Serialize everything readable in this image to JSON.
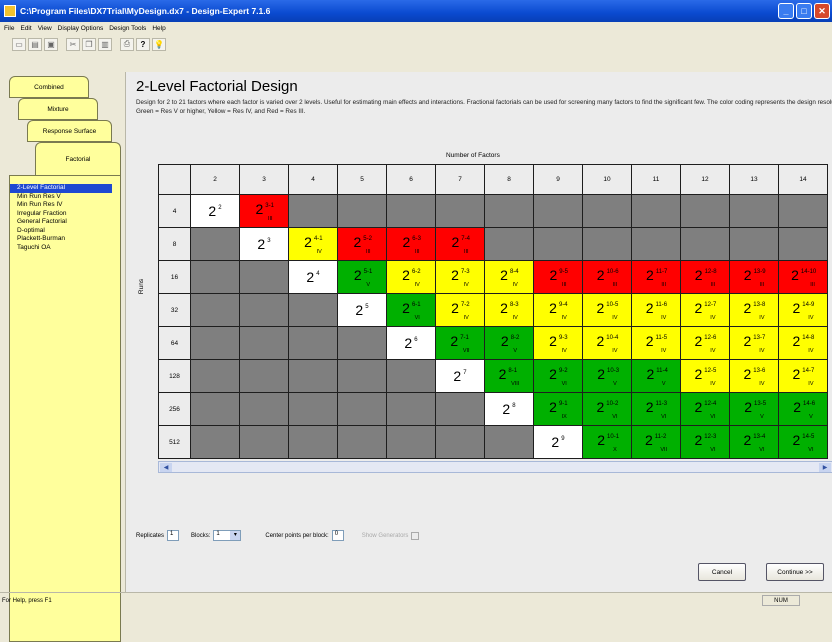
{
  "window": {
    "title": "C:\\Program Files\\DX7Trial\\MyDesign.dx7 - Design-Expert 7.1.6",
    "controls": [
      "_",
      "□",
      "✕"
    ]
  },
  "menu": [
    "File",
    "Edit",
    "View",
    "Display Options",
    "Design Tools",
    "Help"
  ],
  "toolbar": {
    "help_label": "?",
    "tip_label": "💡"
  },
  "tabs": [
    "Combined",
    "Mixture",
    "Response Surface",
    "Factorial"
  ],
  "nav_items": [
    "2-Level Factorial",
    "Min Run Res V",
    "Min Run Res IV",
    "Irregular Fraction",
    "General Factorial",
    "D-optimal",
    "Plackett-Burman",
    "Taguchi OA"
  ],
  "main": {
    "title": "2-Level Factorial Design",
    "description": "Design for 2 to 21 factors where each factor is varied over 2 levels. Useful for estimating main effects and interactions. Fractional factorials can be used for screening many factors to find the significant few. The color coding represents the design resolution: Green = Res V or higher, Yellow = Res IV, and Red = Res III.",
    "factors_label": "Number of Factors",
    "runs_label": "Runs"
  },
  "grid": {
    "factor_headers": [
      "2",
      "3",
      "4",
      "5",
      "6",
      "7",
      "8",
      "9",
      "10",
      "11",
      "12",
      "13",
      "14"
    ],
    "rows": [
      {
        "runs": "4",
        "cells": [
          {
            "c": "white",
            "s": "2"
          },
          {
            "c": "red",
            "s": "3-1",
            "r": "III"
          },
          {
            "c": "empty"
          },
          {
            "c": "empty"
          },
          {
            "c": "empty"
          },
          {
            "c": "empty"
          },
          {
            "c": "empty"
          },
          {
            "c": "empty"
          },
          {
            "c": "empty"
          },
          {
            "c": "empty"
          },
          {
            "c": "empty"
          },
          {
            "c": "empty"
          },
          {
            "c": "empty"
          }
        ]
      },
      {
        "runs": "8",
        "cells": [
          {
            "c": "empty"
          },
          {
            "c": "white",
            "s": "3"
          },
          {
            "c": "yellow",
            "s": "4-1",
            "r": "IV"
          },
          {
            "c": "red",
            "s": "5-2",
            "r": "III"
          },
          {
            "c": "red",
            "s": "6-3",
            "r": "III"
          },
          {
            "c": "red",
            "s": "7-4",
            "r": "III"
          },
          {
            "c": "empty"
          },
          {
            "c": "empty"
          },
          {
            "c": "empty"
          },
          {
            "c": "empty"
          },
          {
            "c": "empty"
          },
          {
            "c": "empty"
          },
          {
            "c": "empty"
          }
        ]
      },
      {
        "runs": "16",
        "cells": [
          {
            "c": "empty"
          },
          {
            "c": "empty"
          },
          {
            "c": "white",
            "s": "4"
          },
          {
            "c": "green",
            "s": "5-1",
            "r": "V"
          },
          {
            "c": "yellow",
            "s": "6-2",
            "r": "IV"
          },
          {
            "c": "yellow",
            "s": "7-3",
            "r": "IV"
          },
          {
            "c": "yellow",
            "s": "8-4",
            "r": "IV"
          },
          {
            "c": "red",
            "s": "9-5",
            "r": "III"
          },
          {
            "c": "red",
            "s": "10-6",
            "r": "III"
          },
          {
            "c": "red",
            "s": "11-7",
            "r": "III"
          },
          {
            "c": "red",
            "s": "12-8",
            "r": "III"
          },
          {
            "c": "red",
            "s": "13-9",
            "r": "III"
          },
          {
            "c": "red",
            "s": "14-10",
            "r": "III"
          }
        ]
      },
      {
        "runs": "32",
        "cells": [
          {
            "c": "empty"
          },
          {
            "c": "empty"
          },
          {
            "c": "empty"
          },
          {
            "c": "white",
            "s": "5"
          },
          {
            "c": "green",
            "s": "6-1",
            "r": "VI"
          },
          {
            "c": "yellow",
            "s": "7-2",
            "r": "IV"
          },
          {
            "c": "yellow",
            "s": "8-3",
            "r": "IV"
          },
          {
            "c": "yellow",
            "s": "9-4",
            "r": "IV"
          },
          {
            "c": "yellow",
            "s": "10-5",
            "r": "IV"
          },
          {
            "c": "yellow",
            "s": "11-6",
            "r": "IV"
          },
          {
            "c": "yellow",
            "s": "12-7",
            "r": "IV"
          },
          {
            "c": "yellow",
            "s": "13-8",
            "r": "IV"
          },
          {
            "c": "yellow",
            "s": "14-9",
            "r": "IV"
          }
        ]
      },
      {
        "runs": "64",
        "cells": [
          {
            "c": "empty"
          },
          {
            "c": "empty"
          },
          {
            "c": "empty"
          },
          {
            "c": "empty"
          },
          {
            "c": "white",
            "s": "6"
          },
          {
            "c": "green",
            "s": "7-1",
            "r": "VII"
          },
          {
            "c": "green",
            "s": "8-2",
            "r": "V"
          },
          {
            "c": "yellow",
            "s": "9-3",
            "r": "IV"
          },
          {
            "c": "yellow",
            "s": "10-4",
            "r": "IV"
          },
          {
            "c": "yellow",
            "s": "11-5",
            "r": "IV"
          },
          {
            "c": "yellow",
            "s": "12-6",
            "r": "IV"
          },
          {
            "c": "yellow",
            "s": "13-7",
            "r": "IV"
          },
          {
            "c": "yellow",
            "s": "14-8",
            "r": "IV"
          }
        ]
      },
      {
        "runs": "128",
        "cells": [
          {
            "c": "empty"
          },
          {
            "c": "empty"
          },
          {
            "c": "empty"
          },
          {
            "c": "empty"
          },
          {
            "c": "empty"
          },
          {
            "c": "white",
            "s": "7"
          },
          {
            "c": "green",
            "s": "8-1",
            "r": "VIII"
          },
          {
            "c": "green",
            "s": "9-2",
            "r": "VI"
          },
          {
            "c": "green",
            "s": "10-3",
            "r": "V"
          },
          {
            "c": "green",
            "s": "11-4",
            "r": "V"
          },
          {
            "c": "yellow",
            "s": "12-5",
            "r": "IV"
          },
          {
            "c": "yellow",
            "s": "13-6",
            "r": "IV"
          },
          {
            "c": "yellow",
            "s": "14-7",
            "r": "IV"
          }
        ]
      },
      {
        "runs": "256",
        "cells": [
          {
            "c": "empty"
          },
          {
            "c": "empty"
          },
          {
            "c": "empty"
          },
          {
            "c": "empty"
          },
          {
            "c": "empty"
          },
          {
            "c": "empty"
          },
          {
            "c": "white",
            "s": "8"
          },
          {
            "c": "green",
            "s": "9-1",
            "r": "IX"
          },
          {
            "c": "green",
            "s": "10-2",
            "r": "VI"
          },
          {
            "c": "green",
            "s": "11-3",
            "r": "VI"
          },
          {
            "c": "green",
            "s": "12-4",
            "r": "VI"
          },
          {
            "c": "green",
            "s": "13-5",
            "r": "V"
          },
          {
            "c": "green",
            "s": "14-6",
            "r": "V"
          }
        ]
      },
      {
        "runs": "512",
        "cells": [
          {
            "c": "empty"
          },
          {
            "c": "empty"
          },
          {
            "c": "empty"
          },
          {
            "c": "empty"
          },
          {
            "c": "empty"
          },
          {
            "c": "empty"
          },
          {
            "c": "empty"
          },
          {
            "c": "white",
            "s": "9"
          },
          {
            "c": "green",
            "s": "10-1",
            "r": "X"
          },
          {
            "c": "green",
            "s": "11-2",
            "r": "VII"
          },
          {
            "c": "green",
            "s": "12-3",
            "r": "VI"
          },
          {
            "c": "green",
            "s": "13-4",
            "r": "VI"
          },
          {
            "c": "green",
            "s": "14-5",
            "r": "VI"
          }
        ]
      }
    ]
  },
  "options": {
    "replicates_label": "Replicates",
    "replicates_value": "1",
    "blocks_label": "Blocks:",
    "blocks_value": "1",
    "center_label": "Center points per block:",
    "center_value": "0",
    "generators_label": "Show Generators"
  },
  "buttons": {
    "cancel": "Cancel",
    "continue": "Continue >>"
  },
  "status": {
    "text": "For Help, press F1",
    "num": "NUM"
  }
}
